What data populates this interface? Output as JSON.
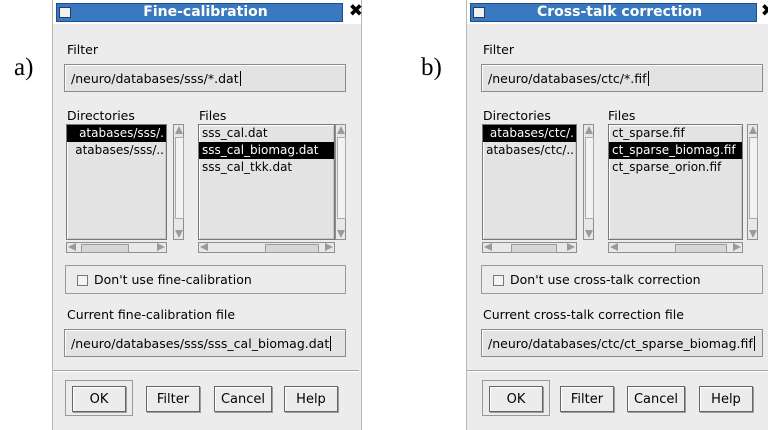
{
  "panel_a": {
    "letter": "a)",
    "title": "Fine-calibration",
    "filter_label": "Filter",
    "filter_value": "/neuro/databases/sss/*.dat",
    "directories_label": "Directories",
    "files_label": "Files",
    "directories": [
      {
        "name": "atabases/sss/.",
        "selected": true
      },
      {
        "name": "atabases/sss/..",
        "selected": false
      }
    ],
    "files": [
      {
        "name": "sss_cal.dat",
        "selected": false
      },
      {
        "name": "sss_cal_biomag.dat",
        "selected": true
      },
      {
        "name": "sss_cal_tkk.dat",
        "selected": false
      }
    ],
    "checkbox_label": "Don't use fine-calibration",
    "current_label": "Current fine-calibration file",
    "current_value": "/neuro/databases/sss/sss_cal_biomag.dat",
    "buttons": {
      "ok": "OK",
      "filter": "Filter",
      "cancel": "Cancel",
      "help": "Help"
    }
  },
  "panel_b": {
    "letter": "b)",
    "title": "Cross-talk correction",
    "filter_label": "Filter",
    "filter_value": "/neuro/databases/ctc/*.fif",
    "directories_label": "Directories",
    "files_label": "Files",
    "directories": [
      {
        "name": "atabases/ctc/.",
        "selected": true
      },
      {
        "name": "atabases/ctc/..",
        "selected": false
      }
    ],
    "files": [
      {
        "name": "ct_sparse.fif",
        "selected": false
      },
      {
        "name": "ct_sparse_biomag.fif",
        "selected": true
      },
      {
        "name": "ct_sparse_orion.fif",
        "selected": false
      }
    ],
    "checkbox_label": "Don't use cross-talk correction",
    "current_label": "Current cross-talk correction file",
    "current_value": "/neuro/databases/ctc/ct_sparse_biomag.fif",
    "buttons": {
      "ok": "OK",
      "filter": "Filter",
      "cancel": "Cancel",
      "help": "Help"
    }
  },
  "icons": {
    "close": "close-icon",
    "window_menu": "window-menu-icon",
    "checkbox": "checkbox-icon"
  }
}
